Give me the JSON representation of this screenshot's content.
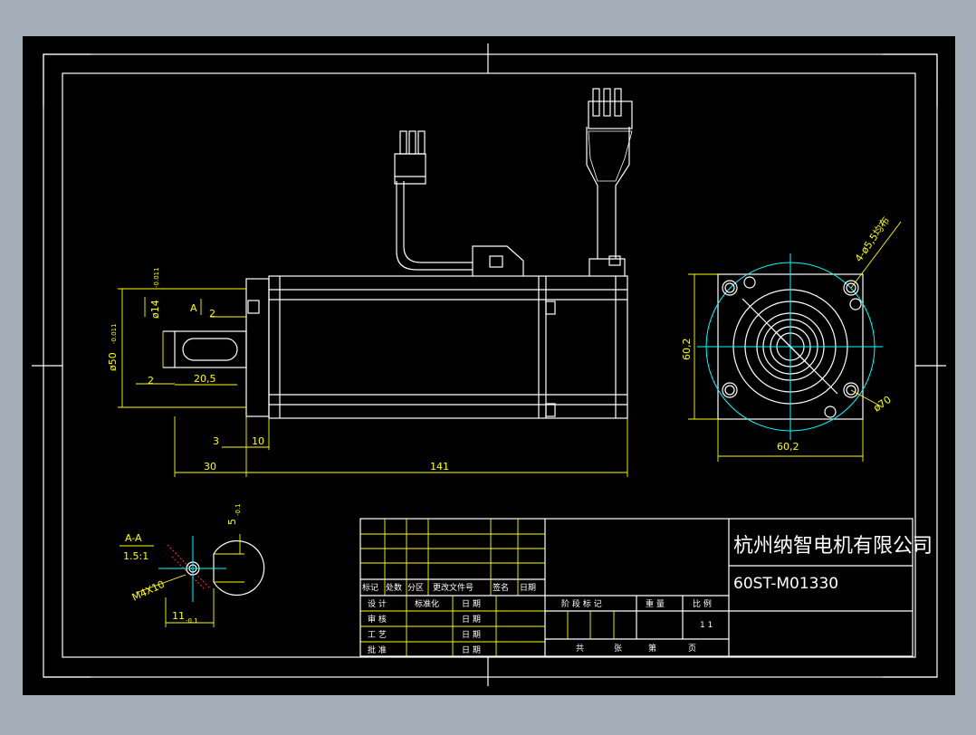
{
  "colors": {
    "background": "#a3acb7",
    "drawing_background": "#000000",
    "outline": "#ffffff",
    "dimension": "#ffff00",
    "circle": "#00ffff",
    "centerline": "#ff3333"
  },
  "side_view": {
    "dims": {
      "shaft_dia": "ø14",
      "shaft_dia_tol": "-0.011",
      "flange_dia": "ø50",
      "flange_dia_tol": "-0.011",
      "section_marker": "A",
      "dim_2_top": "2",
      "dim_2_left": "2",
      "key_length": "20,5",
      "dim_3": "3",
      "dim_10": "10",
      "shaft_length": "30",
      "body_length": "141"
    }
  },
  "front_view": {
    "dims": {
      "height": "60,2",
      "width": "60,2",
      "holes": "4-ø5,5均布",
      "bolt_circle": "ø70"
    }
  },
  "section_view": {
    "title": "A-A",
    "scale": "1.5:1",
    "thread": "M4X10",
    "width": "11",
    "width_tol": "-0.1",
    "depth": "5",
    "depth_tol": "-0.1"
  },
  "title_block": {
    "company": "杭州纳智电机有限公司",
    "model": "60ST-M01330",
    "rev_headers": [
      "标记",
      "处数",
      "分区",
      "更改文件号",
      "签名",
      "日期"
    ],
    "sign_rows": [
      {
        "role": "设 计",
        "std": "标准化",
        "date": "日 期"
      },
      {
        "role": "审 核",
        "std": "",
        "date": "日 期"
      },
      {
        "role": "工 艺",
        "std": "",
        "date": "日 期"
      },
      {
        "role": "批 准",
        "std": "",
        "date": "日 期"
      }
    ],
    "stage_label": "阶 段 标 记",
    "weight_label": "重 量",
    "scale_label": "比 例",
    "scale_value": "1 1",
    "sheets_total": "共",
    "sheets_label": "张",
    "sheet_num": "第",
    "page_label": "页"
  }
}
